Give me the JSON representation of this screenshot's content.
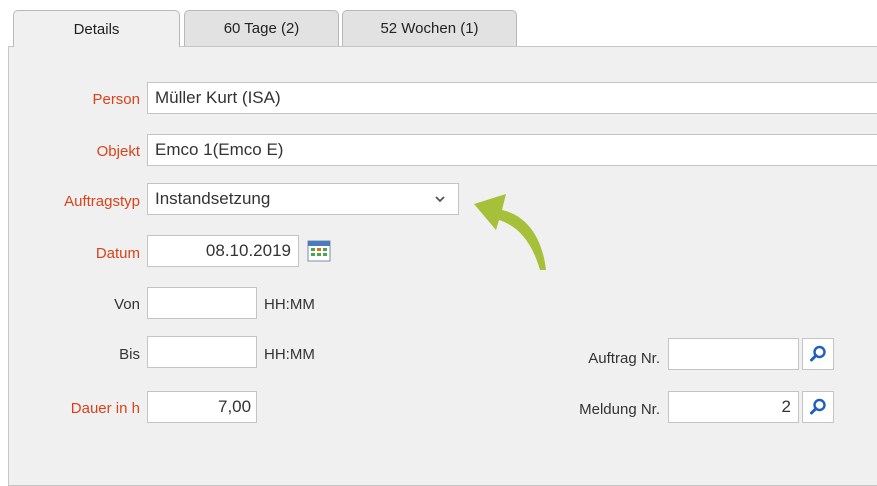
{
  "tabs": [
    {
      "label": "Details"
    },
    {
      "label": "60 Tage (2)"
    },
    {
      "label": "52 Wochen (1)"
    }
  ],
  "form": {
    "person": {
      "label": "Person",
      "value": "Müller Kurt  (ISA)"
    },
    "objekt": {
      "label": "Objekt",
      "value": "Emco 1(Emco E)"
    },
    "auftragstyp": {
      "label": "Auftragstyp",
      "value": "Instandsetzung"
    },
    "datum": {
      "label": "Datum",
      "value": "08.10.2019"
    },
    "von": {
      "label": "Von",
      "value": "",
      "unit": "HH:MM"
    },
    "bis": {
      "label": "Bis",
      "value": "",
      "unit": "HH:MM"
    },
    "dauer": {
      "label": "Dauer in h",
      "value": "7,00"
    },
    "auftrag_nr": {
      "label": "Auftrag Nr.",
      "value": ""
    },
    "meldung_nr": {
      "label": "Meldung Nr.",
      "value": "2"
    }
  },
  "icons": {
    "calendar": "calendar-icon",
    "search": "search-icon",
    "chevron": "chevron-down-icon",
    "annotation": "curved-arrow-icon"
  },
  "colors": {
    "required_label": "#d9431a",
    "arrow": "#a6c03a",
    "lookup_icon": "#1f5fbf"
  }
}
